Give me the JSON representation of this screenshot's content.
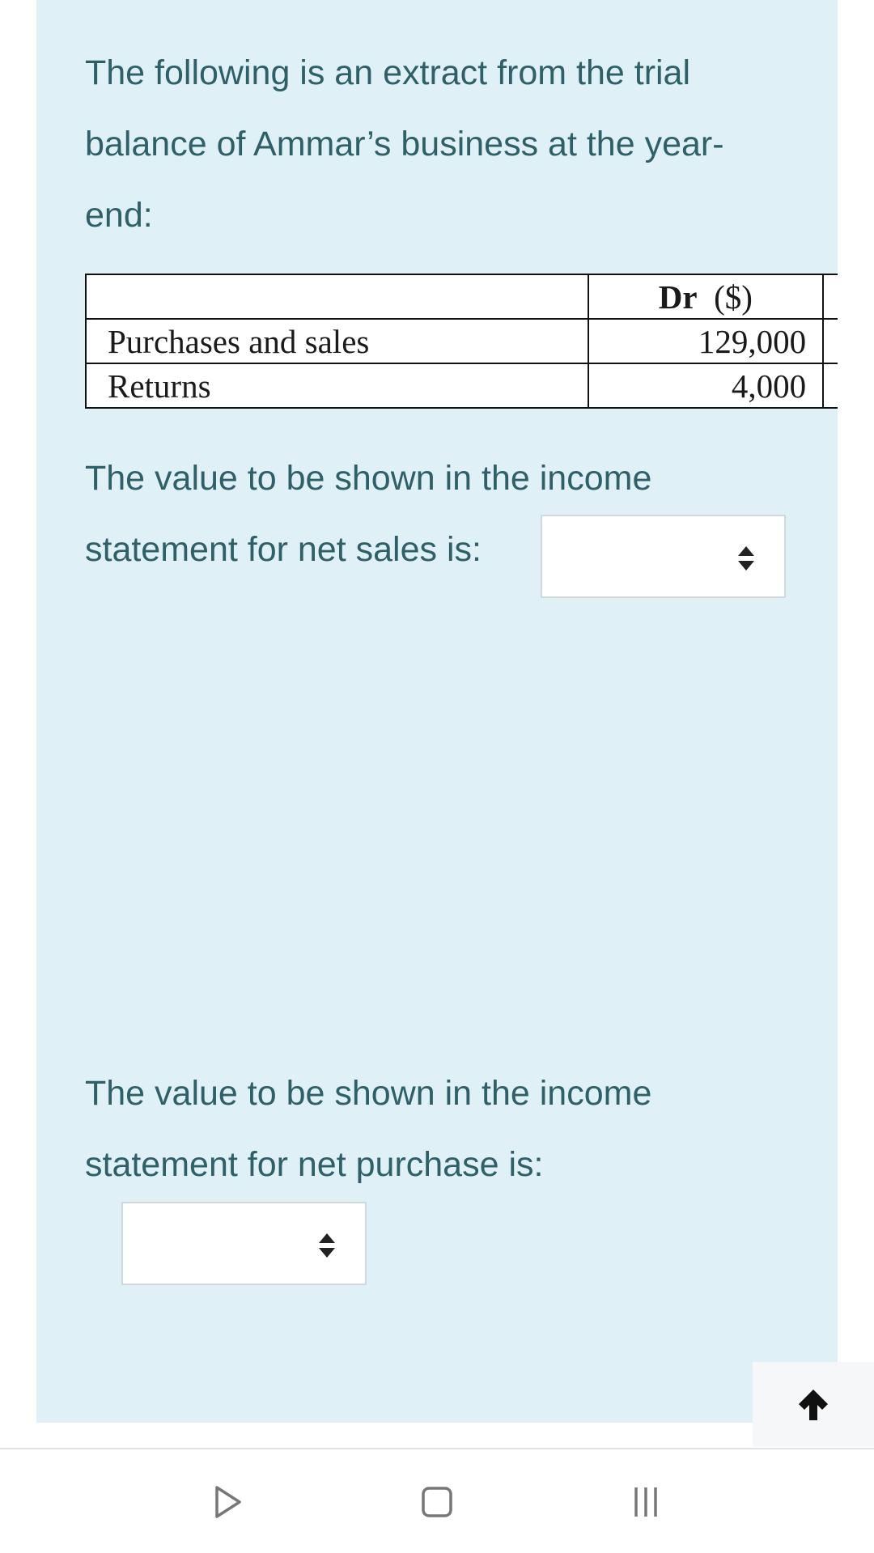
{
  "question": {
    "intro": "The following is an extract from the trial balance of Ammar’s business at the year-end:",
    "q1_text": "The value to be shown in the income statement for net sales is:",
    "q1_selected": "",
    "q2_text": "The value to be shown in the income statement for net purchase is:",
    "q2_selected": ""
  },
  "trial_balance": {
    "header": {
      "label": "",
      "dr_bold": "Dr",
      "dr_unit": "($)"
    },
    "rows": [
      {
        "label": "Purchases and sales",
        "dr": "129,000"
      },
      {
        "label": "Returns",
        "dr": "4,000"
      }
    ]
  },
  "icons": {
    "select_arrows": "sort-arrows-icon",
    "scroll_top": "arrow-up-icon",
    "nav_back": "triangle-back-icon",
    "nav_home": "square-home-icon",
    "nav_recents": "recents-lines-icon"
  },
  "colors": {
    "panel_background": "#dff0f6",
    "question_text": "#2f6068"
  }
}
